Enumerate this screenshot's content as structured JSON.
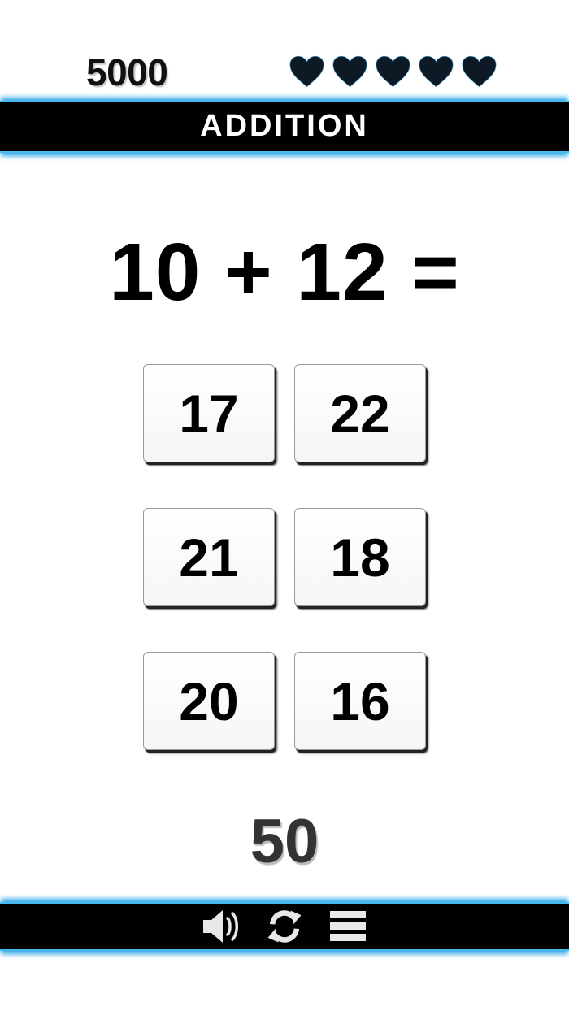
{
  "hud": {
    "score": "5000",
    "lives": 5,
    "heart_color": "#0d1a26"
  },
  "title": "ADDITION",
  "question": {
    "equation": "10 + 12 ="
  },
  "answers": [
    "17",
    "22",
    "21",
    "18",
    "20",
    "16"
  ],
  "timer": "50",
  "toolbar": {
    "icons": [
      "speaker-icon",
      "refresh-icon",
      "menu-icon"
    ]
  },
  "colors": {
    "bar_background": "#000000",
    "bar_glow": "#2fa8e6"
  }
}
